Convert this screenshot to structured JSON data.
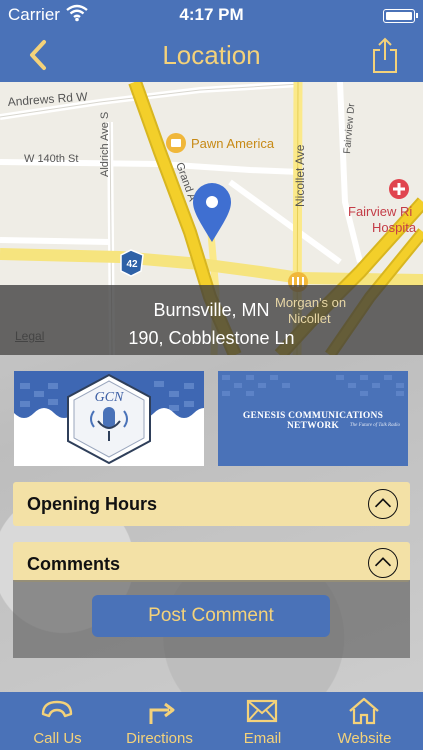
{
  "status_bar": {
    "carrier": "Carrier",
    "time": "4:17 PM",
    "battery_level": 1.0
  },
  "nav": {
    "title": "Location",
    "back_icon": "chevron-left-icon",
    "share_icon": "share-icon"
  },
  "map": {
    "labels": {
      "andrews": "Andrews Rd W",
      "w140": "W 140th St",
      "aldrich": "Aldrich Ave S",
      "grand": "Grand A",
      "nicollet": "Nicollet Ave",
      "fairview_dr": "Fairview Dr",
      "pawn": "Pawn America",
      "fairview1": "Fairview Ri",
      "fairview2": "Hospita",
      "route": "42",
      "morgan1": "Morgan's on",
      "morgan2": "Nicollet"
    },
    "legal": "Legal"
  },
  "address": {
    "city": "Burnsville, MN",
    "street": "190, Cobblestone Ln"
  },
  "banners": {
    "left_logo": "GCN",
    "right_title": "GENESIS COMMUNICATIONS NETWORK",
    "right_tagline": "The Future of Talk Radio"
  },
  "sections": {
    "opening_hours": "Opening Hours",
    "comments": "Comments"
  },
  "post_comment_label": "Post Comment",
  "tabs": [
    {
      "label": "Call Us",
      "icon": "phone-icon"
    },
    {
      "label": "Directions",
      "icon": "turn-arrow-icon"
    },
    {
      "label": "Email",
      "icon": "envelope-icon"
    },
    {
      "label": "Website",
      "icon": "home-icon"
    }
  ],
  "colors": {
    "brand_blue": "#4a72b8",
    "accent_gold": "#f4d27a",
    "section_bg": "#f3e1a6"
  }
}
